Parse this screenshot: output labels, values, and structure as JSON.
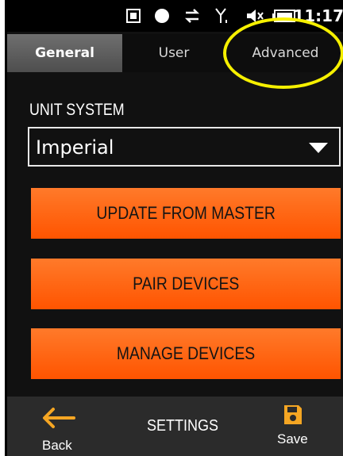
{
  "status_bar": {
    "icons": [
      "notification-icon",
      "record-icon",
      "data-transfer-icon",
      "signal-icon",
      "mute-icon",
      "battery-icon"
    ],
    "time": "11:17"
  },
  "tabs": [
    {
      "label": "General",
      "active": true
    },
    {
      "label": "User",
      "active": false
    },
    {
      "label": "Advanced",
      "active": false
    }
  ],
  "settings": {
    "unit_system_label": "UNIT SYSTEM",
    "unit_system_value": "Imperial"
  },
  "buttons": {
    "update": "UPDATE FROM MASTER",
    "pair": "PAIR DEVICES",
    "manage": "MANAGE DEVICES"
  },
  "bottom_bar": {
    "back_label": "Back",
    "title": "SETTINGS",
    "save_label": "Save"
  },
  "colors": {
    "accent_orange": "#ff6a13",
    "highlight_yellow": "#f6f000",
    "background": "#111111"
  }
}
